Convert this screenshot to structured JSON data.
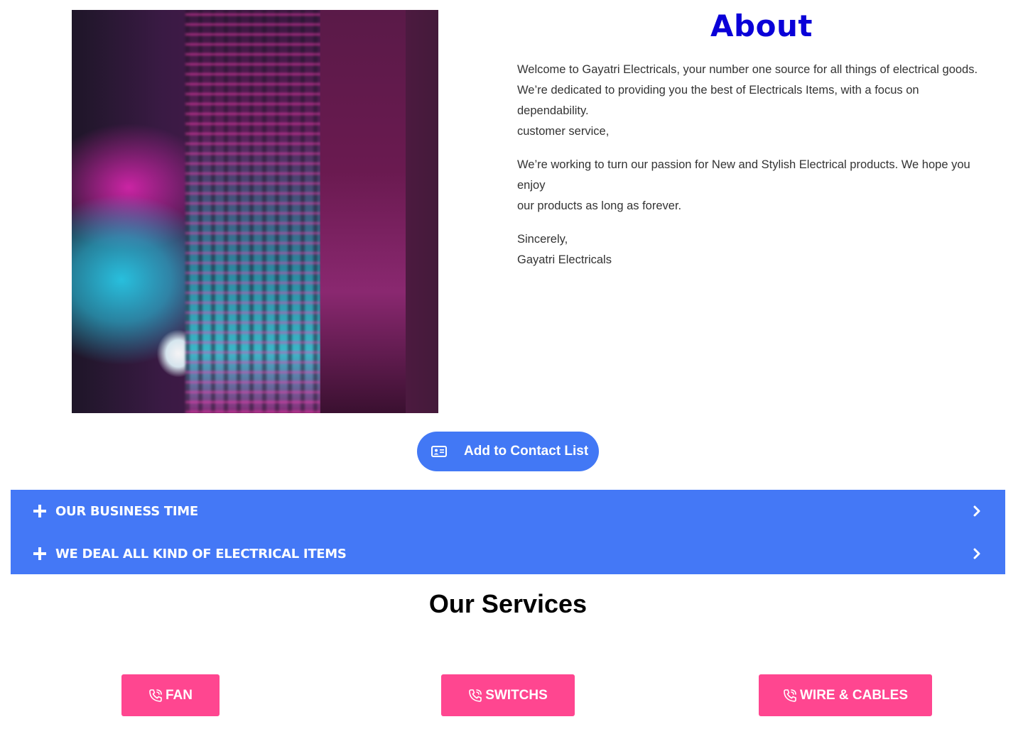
{
  "about": {
    "title": "About",
    "paragraphs": [
      [
        "Welcome to Gayatri Electricals, your number one source for all things of electrical goods.",
        "We’re dedicated to providing you the best of Electricals Items, with a focus on",
        "dependability.",
        "customer service,"
      ],
      [
        "We’re working to turn our passion for New and Stylish Electrical products. We hope you",
        "enjoy",
        "our products as long as forever."
      ],
      [
        "Sincerely,",
        "Gayatri Electricals"
      ]
    ]
  },
  "contact_button": {
    "label": "Add to Contact List",
    "icon": "contact-card-icon"
  },
  "accordion": {
    "items": [
      {
        "label": "OUR BUSINESS TIME",
        "icon": "plus-icon"
      },
      {
        "label": "WE DEAL ALL KIND OF ELECTRICAL ITEMS",
        "icon": "plus-icon"
      }
    ]
  },
  "services": {
    "title": "Our Services",
    "items": [
      {
        "label": "FAN",
        "icon": "phone-icon"
      },
      {
        "label": "SWITCHS",
        "icon": "phone-icon"
      },
      {
        "label": "WIRE & CABLES",
        "icon": "phone-icon"
      }
    ]
  },
  "colors": {
    "about_title": "#0a00d8",
    "primary_blue": "#4478f6",
    "service_pink": "#ff4690"
  }
}
